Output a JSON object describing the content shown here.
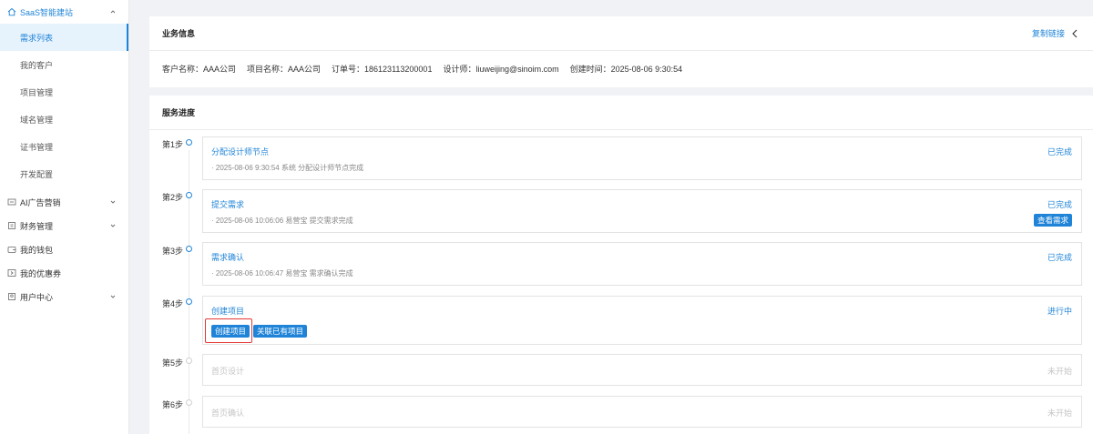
{
  "sidebar": {
    "group_saas": "SaaS智能建站",
    "items": [
      "需求列表",
      "我的客户",
      "项目管理",
      "域名管理",
      "证书管理",
      "开发配置"
    ],
    "group_ai": "AI广告营销",
    "group_finance": "财务管理",
    "wallet": "我的钱包",
    "coupon": "我的优惠券",
    "user_center": "用户中心"
  },
  "business": {
    "title": "业务信息",
    "copy_link": "复制链接",
    "customer": "客户名称：AAA公司",
    "project": "项目名称：AAA公司",
    "order": "订单号：186123113200001",
    "designer": "设计师：liuweijing@sinoim.com",
    "created": "创建时间：2025-08-06 9:30:54"
  },
  "progress": {
    "title": "服务进度",
    "steps": [
      {
        "label": "第1步",
        "title": "分配设计师节点",
        "log": "· 2025-08-06 9:30:54 系统 分配设计师节点完成",
        "status": "已完成"
      },
      {
        "label": "第2步",
        "title": "提交需求",
        "log": "· 2025-08-06 10:06:06 易营宝 提交需求完成",
        "status": "已完成",
        "button": "查看需求"
      },
      {
        "label": "第3步",
        "title": "需求确认",
        "log": "· 2025-08-06 10:06:47 易营宝 需求确认完成",
        "status": "已完成"
      },
      {
        "label": "第4步",
        "title": "创建项目",
        "status": "进行中",
        "buttons": [
          "创建项目",
          "关联已有项目"
        ]
      },
      {
        "label": "第5步",
        "title": "首页设计",
        "status": "未开始"
      },
      {
        "label": "第6步",
        "title": "首页确认",
        "status": "未开始"
      }
    ]
  },
  "colors": {
    "accent": "#1f84d8",
    "highlight": "#e53935"
  }
}
